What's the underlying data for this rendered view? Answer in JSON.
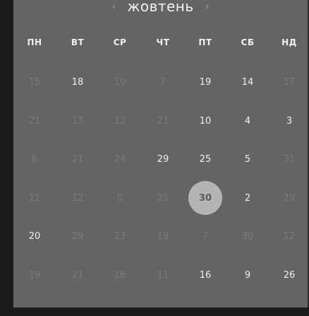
{
  "calendar": {
    "month_label": "жовтень",
    "prev_symbol": "‹",
    "next_symbol": "›",
    "weekdays": [
      "ПН",
      "ВТ",
      "СР",
      "ЧТ",
      "ПТ",
      "СБ",
      "НД"
    ],
    "weeks": [
      [
        {
          "t": "15",
          "a": false
        },
        {
          "t": "18",
          "a": true
        },
        {
          "t": "10",
          "a": false
        },
        {
          "t": "7",
          "a": false
        },
        {
          "t": "19",
          "a": true
        },
        {
          "t": "14",
          "a": true
        },
        {
          "t": "17",
          "a": false
        }
      ],
      [
        {
          "t": "21",
          "a": false
        },
        {
          "t": "13",
          "a": false
        },
        {
          "t": "12",
          "a": false
        },
        {
          "t": "21",
          "a": false
        },
        {
          "t": "10",
          "a": true
        },
        {
          "t": "4",
          "a": true
        },
        {
          "t": "3",
          "a": true
        }
      ],
      [
        {
          "t": "8",
          "a": false
        },
        {
          "t": "21",
          "a": false
        },
        {
          "t": "24",
          "a": false
        },
        {
          "t": "29",
          "a": true
        },
        {
          "t": "25",
          "a": true
        },
        {
          "t": "5",
          "a": true
        },
        {
          "t": "31",
          "a": false
        }
      ],
      [
        {
          "t": "11",
          "a": false
        },
        {
          "t": "12",
          "a": false
        },
        {
          "t": "8",
          "a": false
        },
        {
          "t": "25",
          "a": false
        },
        {
          "t": "30",
          "a": true,
          "selected": true
        },
        {
          "t": "2",
          "a": true
        },
        {
          "t": "29",
          "a": false
        }
      ],
      [
        {
          "t": "20",
          "a": true
        },
        {
          "t": "29",
          "a": false
        },
        {
          "t": "23",
          "a": false
        },
        {
          "t": "19",
          "a": false
        },
        {
          "t": "7",
          "a": false
        },
        {
          "t": "30",
          "a": false
        },
        {
          "t": "12",
          "a": false
        }
      ],
      [
        {
          "t": "19",
          "a": false
        },
        {
          "t": "21",
          "a": false
        },
        {
          "t": "18",
          "a": false
        },
        {
          "t": "11",
          "a": false
        },
        {
          "t": "16",
          "a": true
        },
        {
          "t": "9",
          "a": true
        },
        {
          "t": "26",
          "a": true
        }
      ]
    ]
  },
  "colors": {
    "panel_bg": "#646464",
    "selected_bg": "#b4b4b4",
    "active_text": "#f0f0f0",
    "dim_text": "#7a7a7a"
  }
}
